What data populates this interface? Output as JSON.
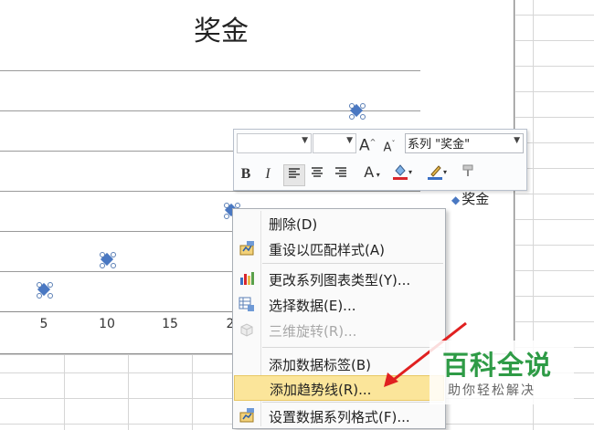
{
  "chart": {
    "title": "奖金",
    "legend_label": "奖金",
    "x_tick_labels": [
      "5",
      "10",
      "15",
      "2"
    ],
    "series_color": "#4a78c2"
  },
  "chart_data": {
    "type": "scatter",
    "title": "奖金",
    "series": [
      {
        "name": "奖金"
      }
    ]
  },
  "mini_toolbar": {
    "font_name": "",
    "font_size": "",
    "grow_font": "A",
    "shrink_font": "A",
    "series_select": "系列 \"奖金\"",
    "bold": "B",
    "italic": "I",
    "font_color": "A",
    "fill_color_icon": "fill-bucket-icon",
    "line_color_icon": "pen-icon",
    "format_painter_icon": "format-painter-icon"
  },
  "context_menu": {
    "items": [
      {
        "label": "删除(D)"
      },
      {
        "label": "重设以匹配样式(A)"
      },
      {
        "label": "更改系列图表类型(Y)..."
      },
      {
        "label": "选择数据(E)..."
      },
      {
        "label": "三维旋转(R)...",
        "disabled": true
      },
      {
        "label": "添加数据标签(B)"
      },
      {
        "label": "添加趋势线(R)...",
        "highlighted": true
      },
      {
        "label": "设置数据系列格式(F)..."
      }
    ]
  },
  "watermark": {
    "title": "百科全说",
    "subtitle": "助你轻松解决",
    "color": "#2e9b46"
  },
  "annotation_arrow_color": "#e02020"
}
